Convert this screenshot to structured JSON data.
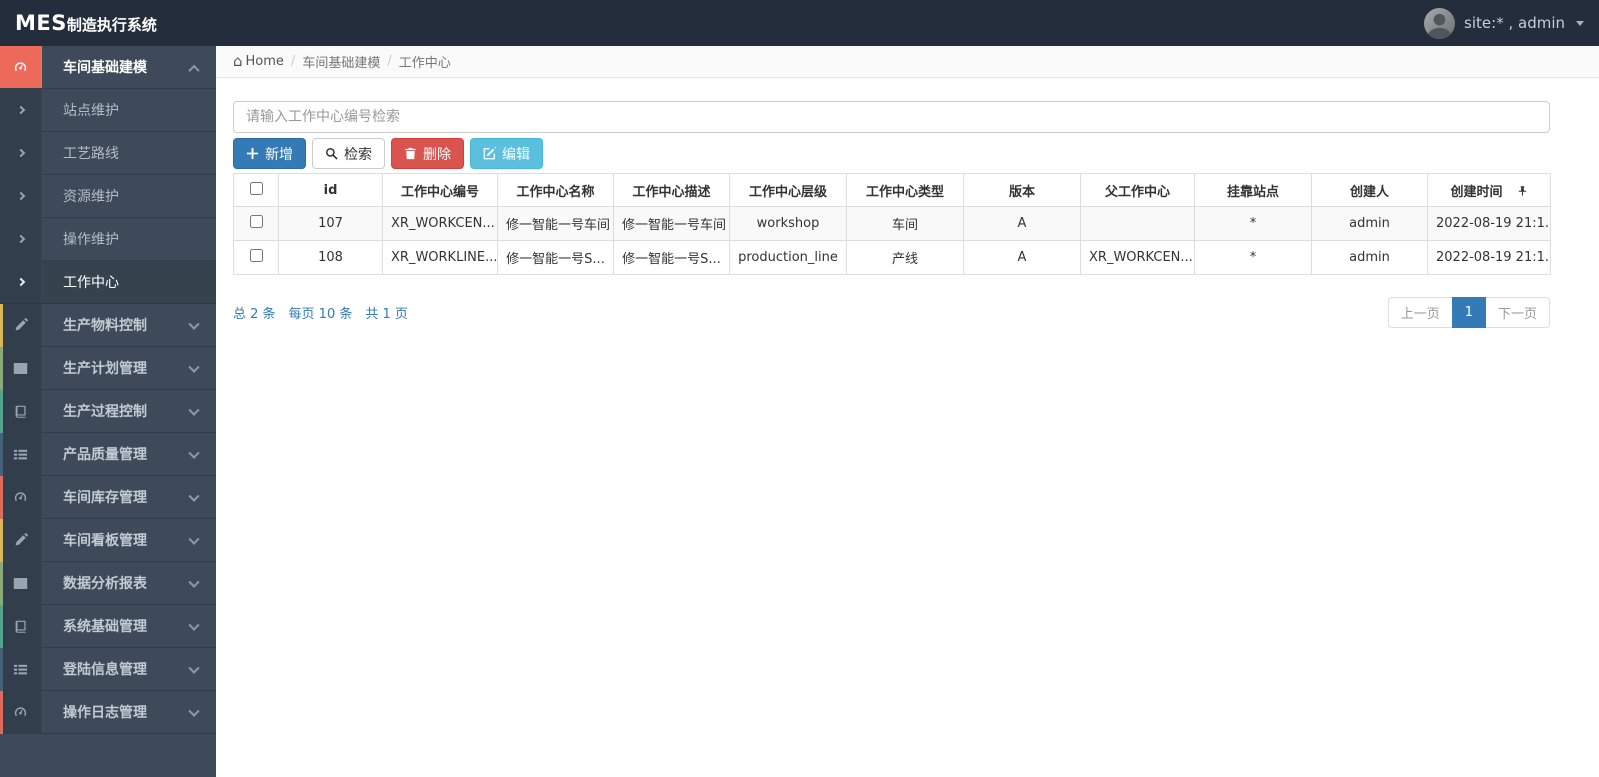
{
  "colors": {
    "navbar_bg": "#232d3b",
    "sidebar_bg": "#3e4a59",
    "sidebar_icon_column": "#333e4c",
    "accent_red": "#ed6a5a",
    "primary_blue": "#337ab7",
    "danger_red": "#d9534f",
    "info_cyan": "#5bc0de",
    "link_blue": "#337ab7",
    "stripe_row_bg": "#f9f9f9",
    "strip_yellow": "#d9b55a",
    "strip_green": "#89a978",
    "strip_teal": "#55a28e",
    "strip_blue": "#46627a",
    "strip_red": "#dd6b62"
  },
  "navbar": {
    "brand_bold": "MES",
    "brand_text": "制造执行系统",
    "user_label": "site:* , admin"
  },
  "breadcrumb": {
    "home": "Home",
    "section": "车间基础建模",
    "page": "工作中心"
  },
  "sidebar": {
    "items": [
      {
        "label": "车间基础建模",
        "icon": "gauge",
        "kind": "parent",
        "state": "expanded-active"
      },
      {
        "label": "站点维护",
        "kind": "child"
      },
      {
        "label": "工艺路线",
        "kind": "child"
      },
      {
        "label": "资源维护",
        "kind": "child"
      },
      {
        "label": "操作维护",
        "kind": "child"
      },
      {
        "label": "工作中心",
        "kind": "child",
        "state": "active"
      },
      {
        "label": "生产物料控制",
        "icon": "pencil",
        "kind": "parent",
        "strip": "#d9b55a"
      },
      {
        "label": "生产计划管理",
        "icon": "columns",
        "kind": "parent",
        "strip": "#89a978"
      },
      {
        "label": "生产过程控制",
        "icon": "book",
        "kind": "parent",
        "strip": "#55a28e"
      },
      {
        "label": "产品质量管理",
        "icon": "list",
        "kind": "parent",
        "strip": "#46627a"
      },
      {
        "label": "车间库存管理",
        "icon": "gauge",
        "kind": "parent",
        "strip": "#dd6b62"
      },
      {
        "label": "车间看板管理",
        "icon": "pencil",
        "kind": "parent",
        "strip": "#d9b55a"
      },
      {
        "label": "数据分析报表",
        "icon": "columns",
        "kind": "parent",
        "strip": "#89a978"
      },
      {
        "label": "系统基础管理",
        "icon": "book",
        "kind": "parent",
        "strip": "#55a28e"
      },
      {
        "label": "登陆信息管理",
        "icon": "list",
        "kind": "parent",
        "strip": "#46627a"
      },
      {
        "label": "操作日志管理",
        "icon": "gauge",
        "kind": "parent",
        "strip": "#dd6b62"
      }
    ]
  },
  "toolbar": {
    "search_placeholder": "请输入工作中心编号检索",
    "add_label": "新增",
    "search_label": "检索",
    "delete_label": "删除",
    "edit_label": "编辑"
  },
  "table": {
    "columns": [
      "id",
      "工作中心编号",
      "工作中心名称",
      "工作中心描述",
      "工作中心层级",
      "工作中心类型",
      "版本",
      "父工作中心",
      "挂靠站点",
      "创建人",
      "创建时间"
    ],
    "rows": [
      {
        "id": "107",
        "code": "XR_WORKCEN...",
        "name": "修一智能一号车间",
        "desc": "修一智能一号车间",
        "level": "workshop",
        "type": "车间",
        "version": "A",
        "parent": "",
        "station": "*",
        "creator": "admin",
        "created": "2022-08-19 21:1..."
      },
      {
        "id": "108",
        "code": "XR_WORKLINE...",
        "name": "修一智能一号S...",
        "desc": "修一智能一号S...",
        "level": "production_line",
        "type": "产线",
        "version": "A",
        "parent": "XR_WORKCEN...",
        "station": "*",
        "creator": "admin",
        "created": "2022-08-19 21:1..."
      }
    ]
  },
  "pagination": {
    "total": "总 2 条",
    "per_page": "每页 10 条",
    "pages": "共 1 页",
    "prev": "上一页",
    "current": "1",
    "next": "下一页"
  }
}
